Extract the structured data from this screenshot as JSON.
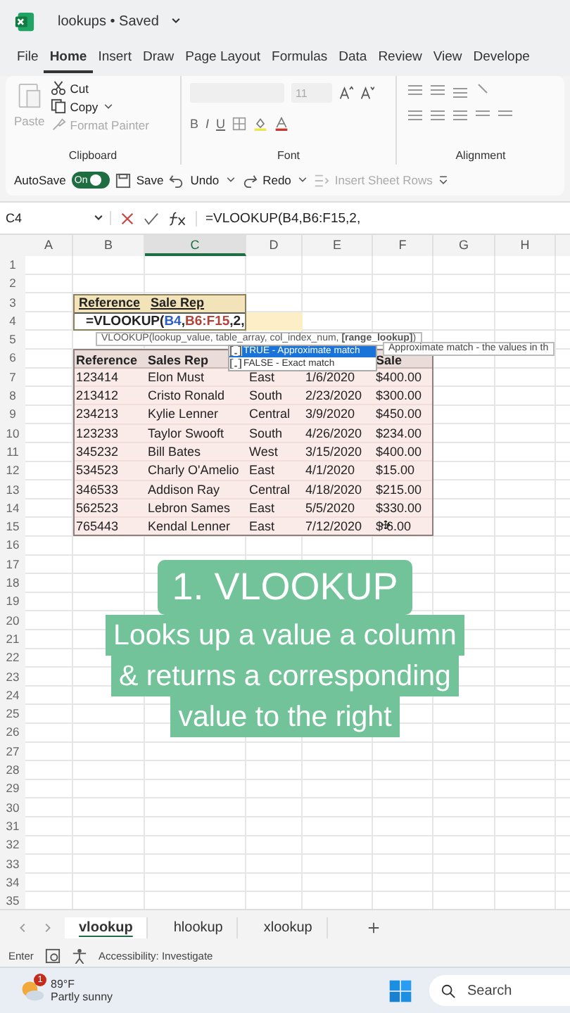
{
  "window": {
    "title": "lookups • Saved"
  },
  "menu_tabs": [
    {
      "label": "File",
      "selected": false
    },
    {
      "label": "Home",
      "selected": true
    },
    {
      "label": "Insert",
      "selected": false
    },
    {
      "label": "Draw",
      "selected": false
    },
    {
      "label": "Page Layout",
      "selected": false
    },
    {
      "label": "Formulas",
      "selected": false
    },
    {
      "label": "Data",
      "selected": false
    },
    {
      "label": "Review",
      "selected": false
    },
    {
      "label": "View",
      "selected": false
    },
    {
      "label": "Develope",
      "selected": false
    }
  ],
  "ribbon": {
    "paste": "Paste",
    "cut": "Cut",
    "copy": "Copy",
    "format_painter": "Format Painter",
    "clipboard_label": "Clipboard",
    "font_size": "11",
    "bold": "B",
    "italic": "I",
    "underline": "U",
    "font_label": "Font",
    "alignment_label": "Alignment"
  },
  "quick_access": {
    "autosave": "AutoSave",
    "autosave_on": true,
    "toggle_label": "On",
    "save": "Save",
    "undo": "Undo",
    "redo": "Redo",
    "insert_rows": "Insert Sheet Rows"
  },
  "formula_bar": {
    "name_box": "C4",
    "formula": "=VLOOKUP(B4,B6:F15,2,"
  },
  "columns": [
    {
      "label": "A",
      "selected": false
    },
    {
      "label": "B",
      "selected": false
    },
    {
      "label": "C",
      "selected": true
    },
    {
      "label": "D",
      "selected": false
    },
    {
      "label": "E",
      "selected": false
    },
    {
      "label": "F",
      "selected": false
    },
    {
      "label": "G",
      "selected": false
    },
    {
      "label": "H",
      "selected": false
    }
  ],
  "row_numbers": [
    "1",
    "2",
    "3",
    "4",
    "5",
    "6",
    "7",
    "8",
    "9",
    "10",
    "11",
    "12",
    "13",
    "14",
    "15",
    "16",
    "17",
    "18",
    "19",
    "20",
    "21",
    "22",
    "23",
    "24",
    "25",
    "26",
    "27",
    "28",
    "29",
    "30",
    "31",
    "32",
    "33",
    "34",
    "35"
  ],
  "lookup_box": {
    "headers": [
      "Reference",
      "Sale Rep"
    ],
    "formula_parts": [
      {
        "text": "=VLOOKUP(",
        "color": "#222222"
      },
      {
        "text": "B4",
        "color": "#2a5cc4"
      },
      {
        "text": ",",
        "color": "#222222"
      },
      {
        "text": "B6:F15",
        "color": "#b0443a"
      },
      {
        "text": ",2,",
        "color": "#222222"
      }
    ]
  },
  "data_table": {
    "columns": [
      "Reference",
      "Sales Rep",
      "",
      "",
      "Sale"
    ],
    "rows": [
      [
        "123414",
        "Elon Must",
        "East",
        "1/6/2020",
        "$400.00"
      ],
      [
        "213412",
        "Cristo Ronald",
        "South",
        "2/23/2020",
        "$300.00"
      ],
      [
        "234213",
        "Kylie Lenner",
        "Central",
        "3/9/2020",
        "$450.00"
      ],
      [
        "123233",
        "Taylor Swooft",
        "South",
        "4/26/2020",
        "$234.00"
      ],
      [
        "345232",
        "Bill Bates",
        "West",
        "3/15/2020",
        "$400.00"
      ],
      [
        "534523",
        "Charly O'Amelio",
        "East",
        "4/1/2020",
        "$15.00"
      ],
      [
        "346533",
        "Addison Ray",
        "Central",
        "4/18/2020",
        "$215.00"
      ],
      [
        "562523",
        "Lebron Sames",
        "East",
        "5/5/2020",
        "$330.00"
      ],
      [
        "765443",
        "Kendal Lenner",
        "East",
        "7/12/2020",
        "$ 6.00"
      ]
    ]
  },
  "function_tooltip": "VLOOKUP(lookup_value, table_array, col_index_num, **[range_lookup]**)",
  "autocomplete": [
    {
      "label": "TRUE - Approximate match",
      "selected": true
    },
    {
      "label": "FALSE - Exact match",
      "selected": false
    }
  ],
  "autocomplete_hint": "Approximate match - the values in th",
  "caption_title": "1. VLOOKUP",
  "caption_lines": [
    "Looks up a value a column",
    "& returns a corresponding",
    "value to the right"
  ],
  "sheet_tabs": [
    {
      "label": "vlookup",
      "selected": true
    },
    {
      "label": "hlookup",
      "selected": false
    },
    {
      "label": "xlookup",
      "selected": false
    }
  ],
  "status_bar": {
    "mode": "Enter",
    "accessibility": "Accessibility: Investigate"
  },
  "taskbar": {
    "temperature": "89°F",
    "weather": "Partly sunny",
    "badge": "1",
    "search": "Search"
  }
}
